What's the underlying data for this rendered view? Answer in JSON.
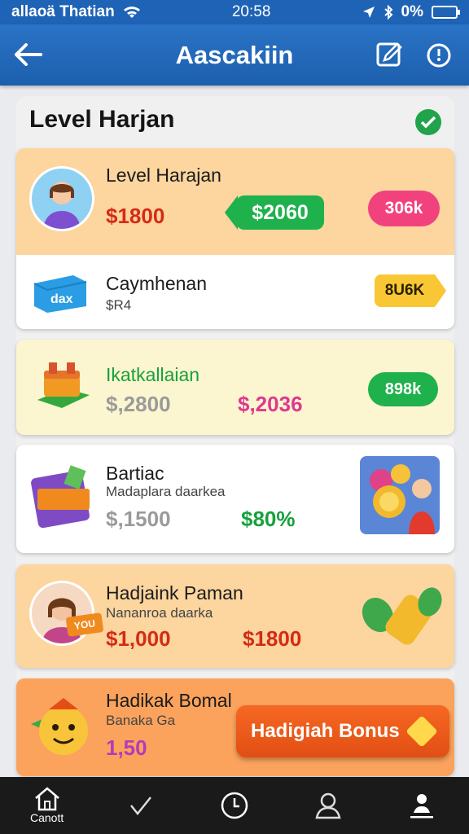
{
  "status": {
    "carrier": "allaoä Thatian",
    "time": "20:58",
    "battery": "0%"
  },
  "header": {
    "title": "Aascakiin"
  },
  "panel": {
    "title": "Level Harjan"
  },
  "cards": [
    {
      "name": "Level Harajan",
      "price": "$1800",
      "tag": "$2060",
      "pill": "306k"
    },
    {
      "name": "Caymhenan",
      "sub": "$R4",
      "tag": "8U6K",
      "icon_text": "dax"
    },
    {
      "name": "Ikatkallaian",
      "price": "$,2800",
      "price2": "$,2036",
      "pill": "898k"
    },
    {
      "name": "Bartiac",
      "sub": "Madaplara daarkea",
      "price": "$,1500",
      "price2": "$80%"
    },
    {
      "name": "Hadjaink Paman",
      "sub": "Nananroa daarka",
      "price": "$1,000",
      "price2": "$1800",
      "icon_text": "YOU"
    },
    {
      "name": "Hadikak Bomal",
      "sub": "Banaka Ga",
      "price": "1,50"
    }
  ],
  "bonus": {
    "label": "Hadigiah Bonus"
  },
  "nav": {
    "home_label": "Canott"
  },
  "colors": {
    "primary": "#1e63b6",
    "orange": "#fcd59f",
    "green": "#1fb14b",
    "pink": "#f2427e"
  }
}
